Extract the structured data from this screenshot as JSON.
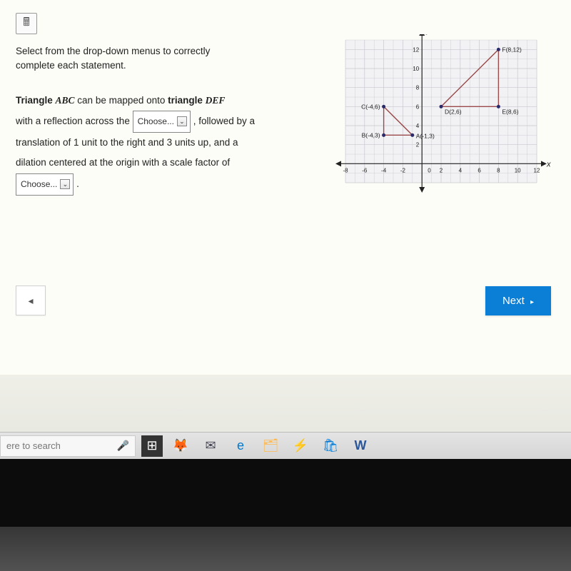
{
  "toolbar": {
    "calc_icon": "🖩"
  },
  "prompt": "Select from the drop-down menus to correctly complete each statement.",
  "question": {
    "line1_a": "Triangle ",
    "line1_b": "ABC",
    "line1_c": "  can be mapped onto ",
    "line1_d": "triangle ",
    "line1_e": "DEF",
    "line2_a": "with a reflection across the ",
    "line2_b": ", followed by a",
    "line3": "translation of 1 unit to the right and 3 units up, and a",
    "line4": "dilation centered at the origin with a scale factor of"
  },
  "dropdown": {
    "placeholder": "Choose...",
    "chev": "⌄"
  },
  "nav": {
    "back": "◂",
    "next": "Next",
    "next_arrow": "▸"
  },
  "taskbar": {
    "search_placeholder": "ere to search",
    "mic": "🎤"
  },
  "chart_data": {
    "type": "scatter",
    "title": "",
    "xlabel": "x",
    "ylabel": "y",
    "xlim": [
      -8,
      12
    ],
    "ylim": [
      -2,
      13
    ],
    "xticks": [
      -8,
      -6,
      -4,
      -2,
      0,
      2,
      4,
      6,
      8,
      10,
      12
    ],
    "yticks": [
      0,
      2,
      4,
      6,
      8,
      10,
      12
    ],
    "points": {
      "A": {
        "x": -1,
        "y": 3,
        "label": "A(-1,3)"
      },
      "B": {
        "x": -4,
        "y": 3,
        "label": "B(-4,3)"
      },
      "C": {
        "x": -4,
        "y": 6,
        "label": "C(-4,6)"
      },
      "D": {
        "x": 2,
        "y": 6,
        "label": "D(2,6)"
      },
      "E": {
        "x": 8,
        "y": 6,
        "label": "E(8,6)"
      },
      "F": {
        "x": 8,
        "y": 12,
        "label": "F(8,12)"
      }
    },
    "triangles": [
      [
        "A",
        "B",
        "C"
      ],
      [
        "D",
        "E",
        "F"
      ]
    ]
  }
}
